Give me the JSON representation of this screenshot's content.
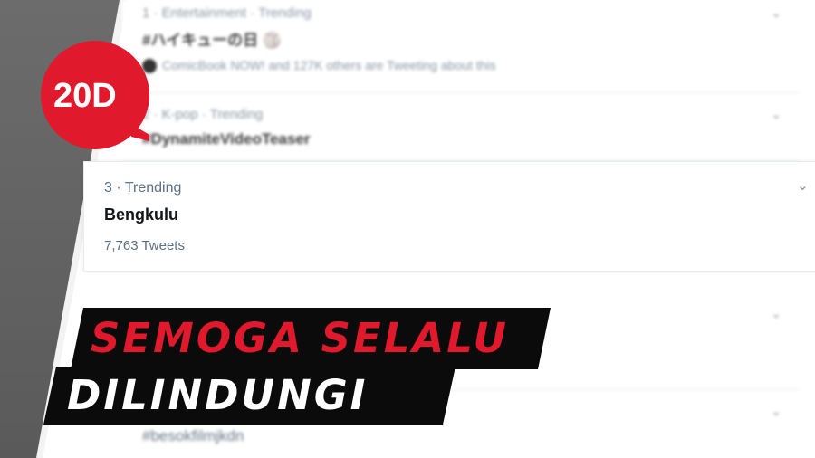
{
  "trends": [
    {
      "meta": "1 · Entertainment · Trending",
      "name": "#ハイキューの日 🏐",
      "sub": "ComicBook NOW! and 127K others are Tweeting about this"
    },
    {
      "meta": "2 · K-pop · Trending",
      "name": "#DynamiteVideoTeaser",
      "sub": ""
    },
    {
      "meta": "3 · Trending",
      "name": "Bengkulu",
      "sub": "7,763 Tweets"
    },
    {
      "meta": "",
      "name": "",
      "sub": ""
    },
    {
      "meta": "",
      "name": "#besokfilmjkdn",
      "sub": ""
    }
  ],
  "logo": {
    "text": "20D",
    "color": "#e0192d"
  },
  "caption": {
    "line1": "SEMOGA SELALU",
    "line2": "DILINDUNGI",
    "line1_color": "#e0192d",
    "line2_color": "#ffffff",
    "bg_color": "#0b0b0b"
  },
  "icons": {
    "chevron": "chevron-down-icon",
    "avatar": "avatar"
  }
}
